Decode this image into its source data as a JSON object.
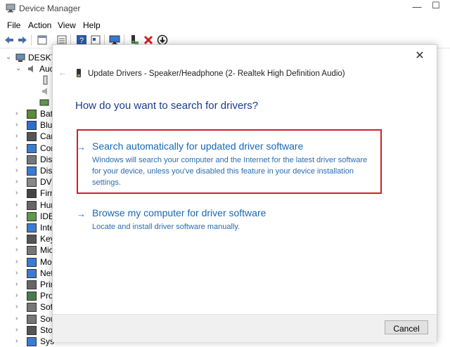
{
  "window": {
    "title": "Device Manager"
  },
  "menu": [
    "File",
    "Action",
    "View",
    "Help"
  ],
  "tree": {
    "root_label": "DESKTO",
    "audio_label": "Auc",
    "items": [
      "Bat",
      "Blu",
      "Car",
      "Cor",
      "Disl",
      "Disp",
      "DVD",
      "Firn",
      "Hur",
      "IDE",
      "Inte",
      "Key",
      "Mic",
      "Mo",
      "Net",
      "Prin",
      "Pro",
      "Sof",
      "Sou",
      "Sto",
      "Sys"
    ]
  },
  "dialog": {
    "header": "Update Drivers - Speaker/Headphone (2- Realtek High Definition Audio)",
    "question": "How do you want to search for drivers?",
    "options": [
      {
        "arrow": "→",
        "title": "Search automatically for updated driver software",
        "description": "Windows will search your computer and the Internet for the latest driver software for your device, unless you've disabled this feature in your device installation settings."
      },
      {
        "arrow": "→",
        "title": "Browse my computer for driver software",
        "description": "Locate and install driver software manually."
      }
    ],
    "cancel_label": "Cancel",
    "close_symbol": "✕",
    "back_symbol": "←"
  },
  "colors": {
    "link": "#1667b7",
    "highlight": "#d0202a"
  }
}
